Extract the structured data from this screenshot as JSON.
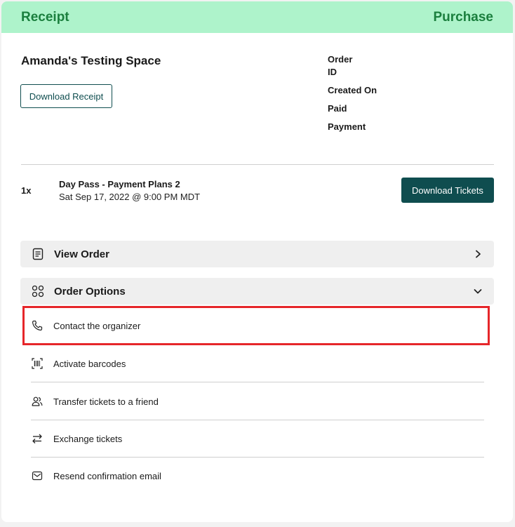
{
  "header": {
    "left_title": "Receipt",
    "right_title": "Purchase"
  },
  "organizer": {
    "name": "Amanda's Testing Space",
    "download_receipt_label": "Download Receipt"
  },
  "order_info": {
    "order_id_label_line1": "Order",
    "order_id_label_line2": "ID",
    "created_on_label": "Created On",
    "paid_label": "Paid",
    "payment_label": "Payment"
  },
  "ticket": {
    "quantity": "1x",
    "name": "Day Pass - Payment Plans 2",
    "date": "Sat Sep 17, 2022 @ 9:00 PM MDT",
    "download_tickets_label": "Download Tickets"
  },
  "view_order": {
    "label": "View Order",
    "icon": "document-icon",
    "chevron": "chevron-right-icon"
  },
  "order_options": {
    "label": "Order Options",
    "icon": "grid-circles-icon",
    "chevron": "chevron-down-icon",
    "items": [
      {
        "label": "Contact the organizer",
        "icon": "phone-icon"
      },
      {
        "label": "Activate barcodes",
        "icon": "barcode-icon"
      },
      {
        "label": "Transfer tickets to a friend",
        "icon": "users-icon"
      },
      {
        "label": "Exchange tickets",
        "icon": "swap-arrows-icon"
      },
      {
        "label": "Resend confirmation email",
        "icon": "envelope-icon"
      }
    ]
  },
  "colors": {
    "header_bg": "#aef3cb",
    "header_text": "#1b7f3e",
    "primary": "#0f4d4f",
    "highlight": "#e6262a"
  }
}
